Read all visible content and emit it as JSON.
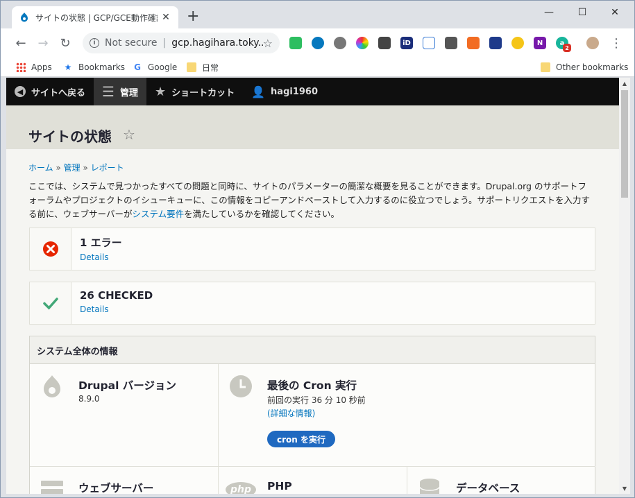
{
  "browser": {
    "tab_title": "サイトの状態 | GCP/GCE動作確認用",
    "tab_close": "✕",
    "new_tab": "+",
    "minimize": "—",
    "maximize": "☐",
    "close": "✕",
    "security_label": "Not secure",
    "url": "gcp.hagihara.toky...",
    "bookmarks": [
      {
        "label": "Apps"
      },
      {
        "label": "Bookmarks"
      },
      {
        "label": "Google"
      },
      {
        "label": "日常"
      },
      {
        "label": "Other bookmarks"
      }
    ],
    "ext_badge": "2"
  },
  "admin_toolbar": {
    "back": "サイトへ戻る",
    "manage": "管理",
    "shortcuts": "ショートカット",
    "user": "hagi1960"
  },
  "page": {
    "title": "サイトの状態",
    "breadcrumb": [
      "ホーム",
      "管理",
      "レポート"
    ],
    "breadcrumb_sep": "»",
    "description_before": "ここでは、システムで見つかったすべての問題と同時に、サイトのパラメーターの簡潔な概要を見ることができます。Drupal.org のサポートフォーラムやプロジェクトのイシューキューに、この情報をコピーアンドペーストして入力するのに役立つでしょう。サポートリクエストを入力する前に、ウェブサーバーが",
    "description_link": "システム要件",
    "description_after": "を満たしているかを確認してください。"
  },
  "status": {
    "errors": {
      "headline": "1 エラー",
      "details": "Details"
    },
    "checked": {
      "headline": "26 CHECKED",
      "details": "Details"
    }
  },
  "system_info": {
    "heading": "システム全体の情報",
    "drupal": {
      "title": "Drupal バージョン",
      "value": "8.9.0"
    },
    "cron": {
      "title": "最後の Cron 実行",
      "value": "前回の実行 36 分 10 秒前",
      "link": "(詳細な情報)",
      "button": "cron を実行"
    },
    "webserver": {
      "title": "ウェブサーバー"
    },
    "php": {
      "title": "PHP",
      "icon_text": "php"
    },
    "database": {
      "title": "データベース"
    }
  },
  "colors": {
    "error": "#e62600",
    "ok": "#42a877",
    "link": "#0074bd",
    "button": "#1f69c0"
  }
}
